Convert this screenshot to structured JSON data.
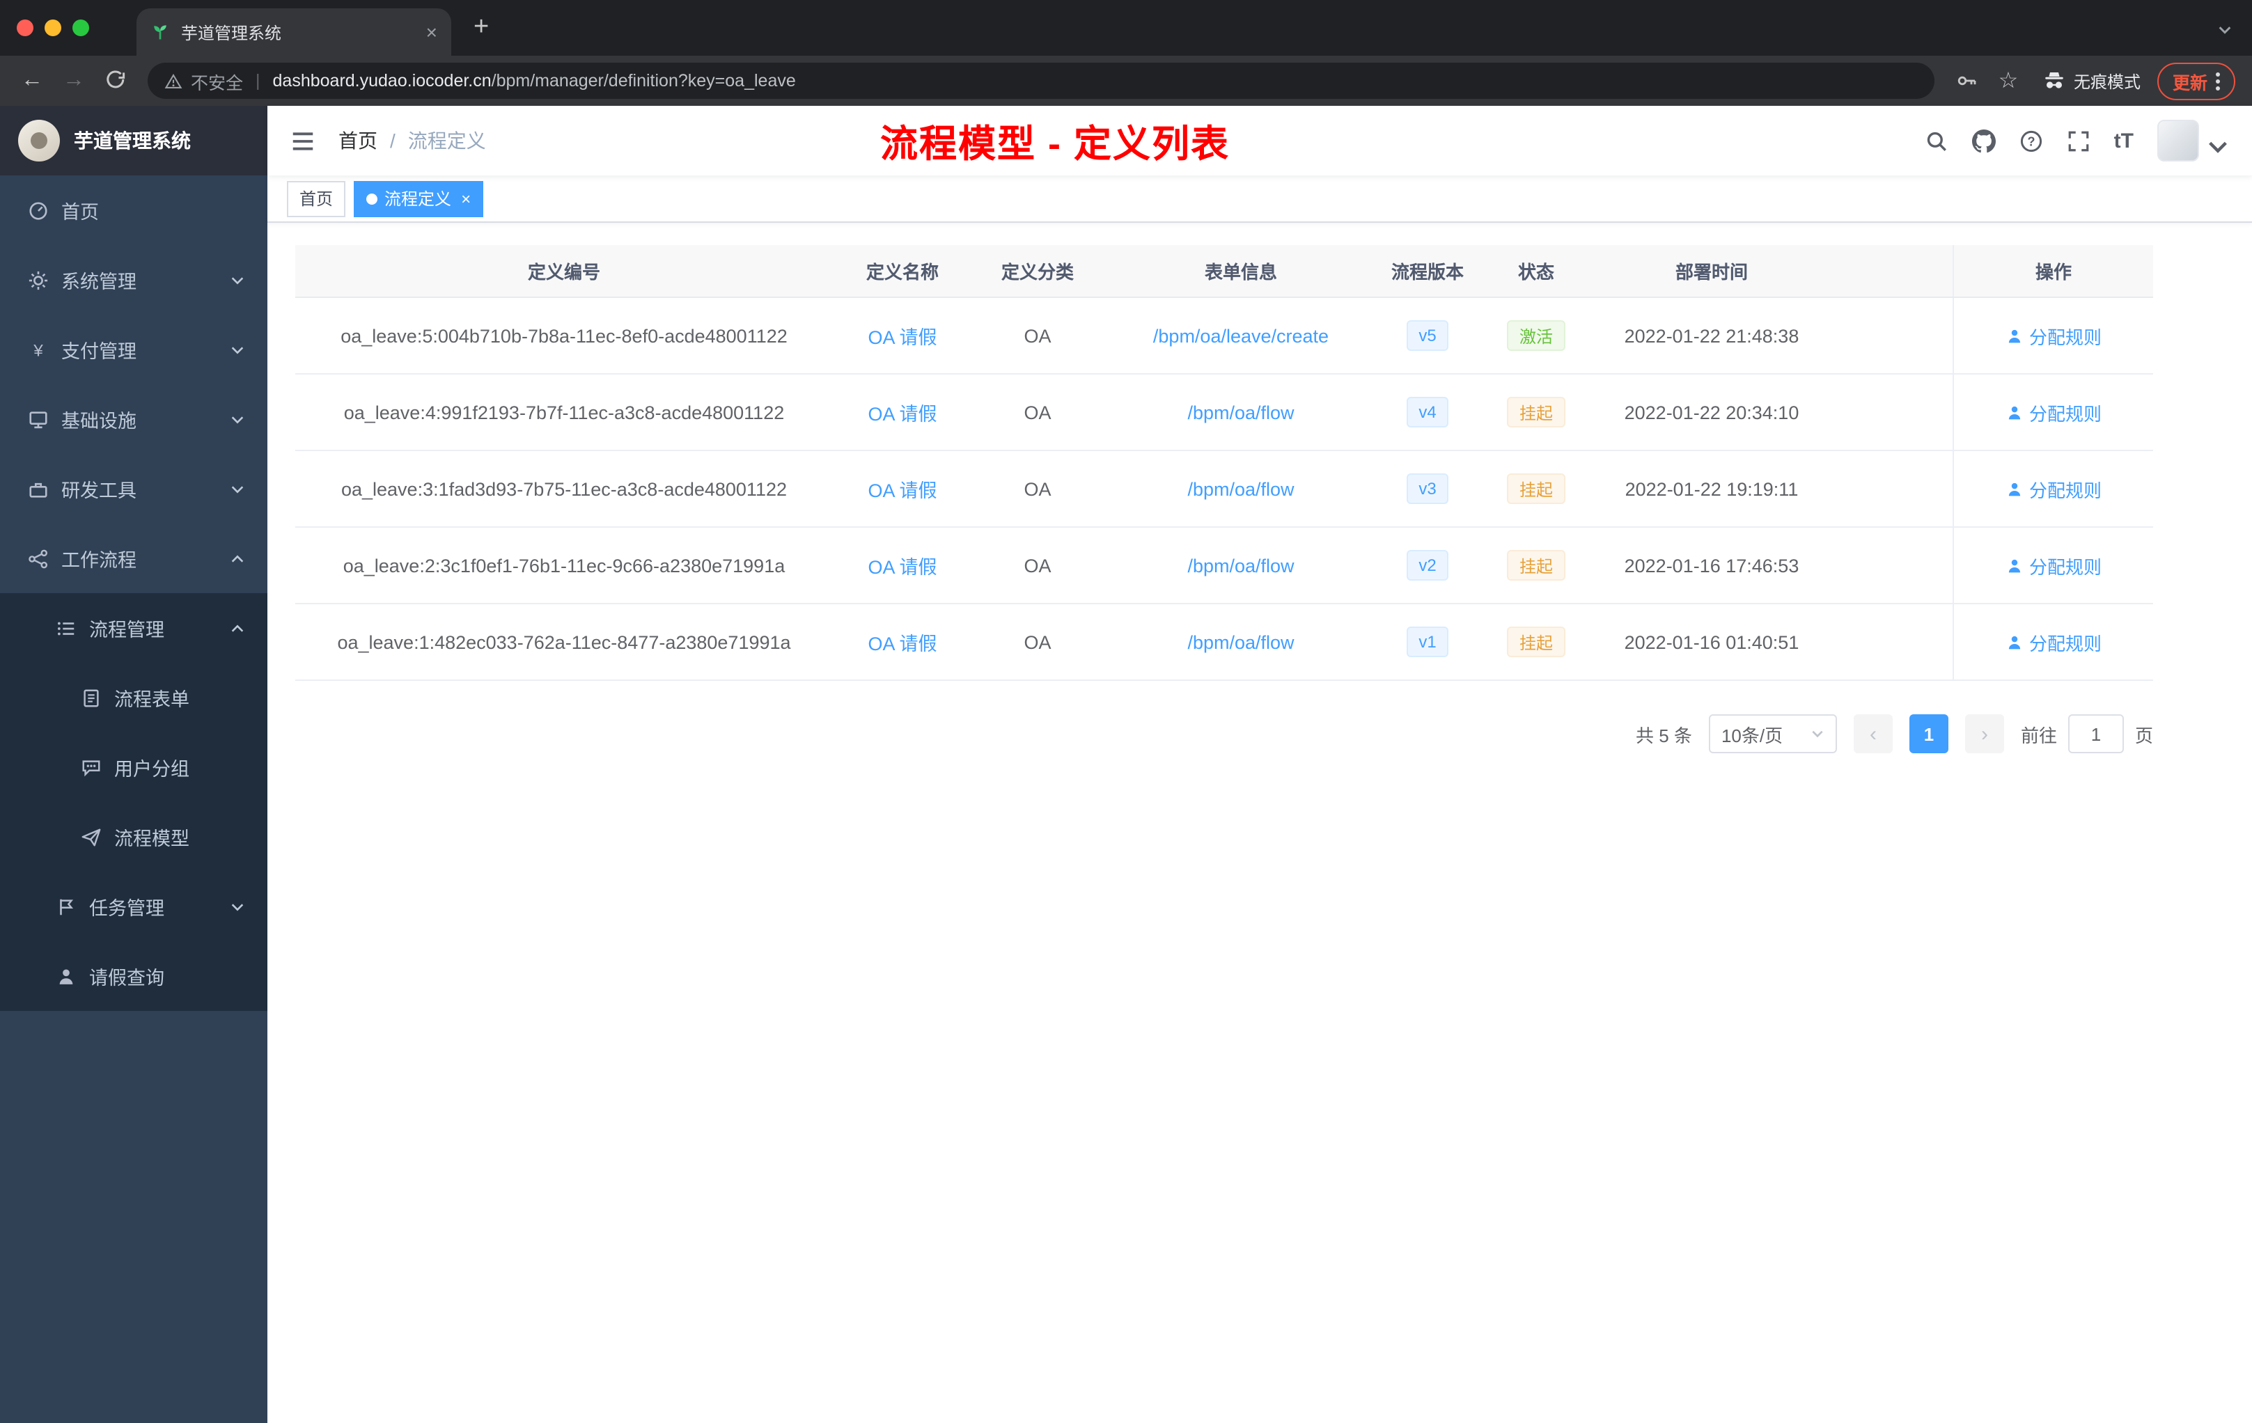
{
  "browser": {
    "tab": {
      "title": "芋道管理系统"
    },
    "toolbar": {
      "security_label": "不安全",
      "url_domain": "dashboard.yudao.iocoder.cn",
      "url_path": "/bpm/manager/definition?key=oa_leave",
      "incognito_label": "无痕模式",
      "update_label": "更新"
    }
  },
  "sidebar": {
    "logo_title": "芋道管理系统",
    "items": [
      {
        "label": "首页"
      },
      {
        "label": "系统管理"
      },
      {
        "label": "支付管理"
      },
      {
        "label": "基础设施"
      },
      {
        "label": "研发工具"
      },
      {
        "label": "工作流程"
      },
      {
        "label": "流程管理"
      },
      {
        "label": "流程表单"
      },
      {
        "label": "用户分组"
      },
      {
        "label": "流程模型"
      },
      {
        "label": "任务管理"
      },
      {
        "label": "请假查询"
      }
    ]
  },
  "header": {
    "breadcrumb_home": "首页",
    "breadcrumb_separator": "/",
    "breadcrumb_current": "流程定义",
    "annotation": "流程模型 - 定义列表"
  },
  "tags": {
    "home": "首页",
    "active": "流程定义"
  },
  "table": {
    "columns": {
      "id": "定义编号",
      "name": "定义名称",
      "category": "定义分类",
      "form": "表单信息",
      "version": "流程版本",
      "status": "状态",
      "time": "部署时间",
      "action": "操作"
    },
    "rows": [
      {
        "id": "oa_leave:5:004b710b-7b8a-11ec-8ef0-acde48001122",
        "name": "OA 请假",
        "category": "OA",
        "form": "/bpm/oa/leave/create",
        "version": "v5",
        "status": "激活",
        "status_type": "success",
        "time": "2022-01-22 21:48:38",
        "action": "分配规则"
      },
      {
        "id": "oa_leave:4:991f2193-7b7f-11ec-a3c8-acde48001122",
        "name": "OA 请假",
        "category": "OA",
        "form": "/bpm/oa/flow",
        "version": "v4",
        "status": "挂起",
        "status_type": "warning",
        "time": "2022-01-22 20:34:10",
        "action": "分配规则"
      },
      {
        "id": "oa_leave:3:1fad3d93-7b75-11ec-a3c8-acde48001122",
        "name": "OA 请假",
        "category": "OA",
        "form": "/bpm/oa/flow",
        "version": "v3",
        "status": "挂起",
        "status_type": "warning",
        "time": "2022-01-22 19:19:11",
        "action": "分配规则"
      },
      {
        "id": "oa_leave:2:3c1f0ef1-76b1-11ec-9c66-a2380e71991a",
        "name": "OA 请假",
        "category": "OA",
        "form": "/bpm/oa/flow",
        "version": "v2",
        "status": "挂起",
        "status_type": "warning",
        "time": "2022-01-16 17:46:53",
        "action": "分配规则"
      },
      {
        "id": "oa_leave:1:482ec033-762a-11ec-8477-a2380e71991a",
        "name": "OA 请假",
        "category": "OA",
        "form": "/bpm/oa/flow",
        "version": "v1",
        "status": "挂起",
        "status_type": "warning",
        "time": "2022-01-16 01:40:51",
        "action": "分配规则"
      }
    ]
  },
  "pagination": {
    "total": "共 5 条",
    "page_size": "10条/页",
    "current_page": "1",
    "goto_label": "前往",
    "goto_value": "1",
    "goto_unit": "页"
  },
  "icons": {
    "tab-favicon": "green-sprout",
    "security-icon": "warning-triangle",
    "incognito-icon": "hat-and-glasses",
    "nav-right": [
      "search-icon",
      "github-icon",
      "help-icon",
      "fullscreen-icon",
      "font-size-icon",
      "avatar"
    ],
    "action-icon": "person"
  },
  "colors": {
    "accent": "#409eff",
    "success": "#67c23a",
    "warning": "#e6a23c",
    "annotation_red": "#ff0000",
    "sidebar_bg": "#304156",
    "submenu_bg": "#1f2d3d",
    "update_red": "#f2573f"
  }
}
